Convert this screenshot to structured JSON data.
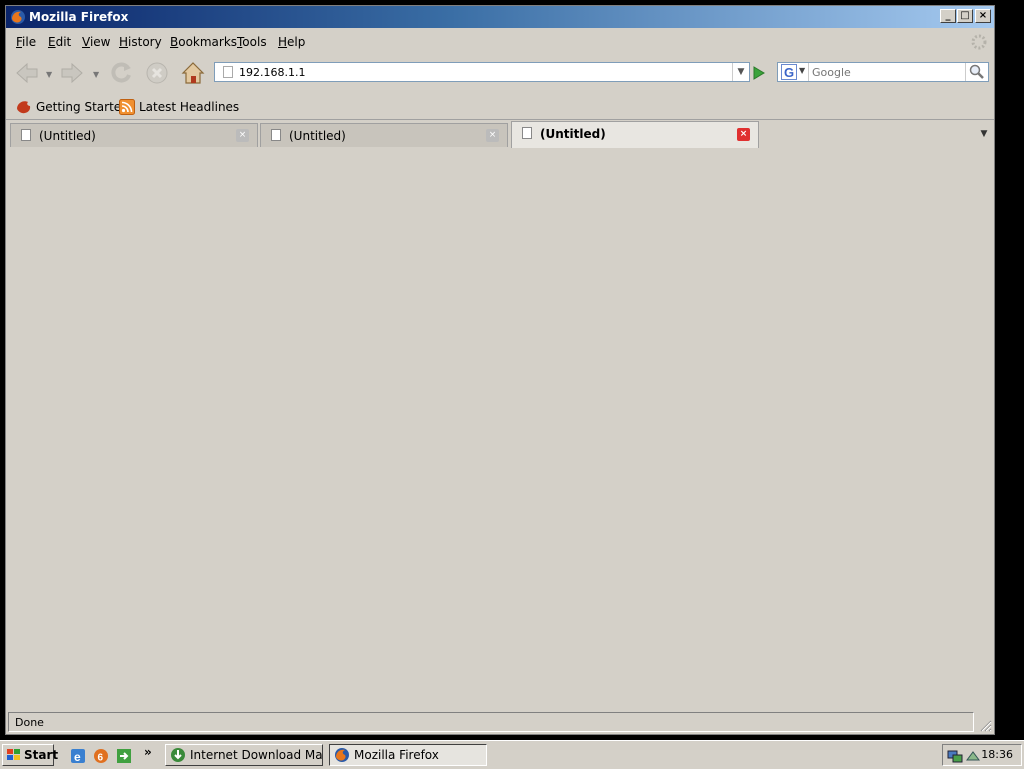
{
  "window": {
    "title": "Mozilla Firefox"
  },
  "menu": [
    "File",
    "Edit",
    "View",
    "History",
    "Bookmarks",
    "Tools",
    "Help"
  ],
  "navigation": {
    "url": "192.168.1.1",
    "search_placeholder": "Google"
  },
  "bookmarks": [
    {
      "label": "Getting Started",
      "icon": "firefox-bookmark-icon"
    },
    {
      "label": "Latest Headlines",
      "icon": "rss-feed-icon"
    }
  ],
  "tabs": [
    {
      "label": "(Untitled)",
      "active": false
    },
    {
      "label": "(Untitled)",
      "active": false
    },
    {
      "label": "(Untitled)",
      "active": true
    }
  ],
  "status": {
    "text": "Done"
  },
  "taskbar": {
    "start_label": "Start",
    "tasks": [
      {
        "label": "Internet Download Mana...",
        "active": false
      },
      {
        "label": "Mozilla Firefox",
        "active": true
      }
    ],
    "clock": "18:36"
  }
}
